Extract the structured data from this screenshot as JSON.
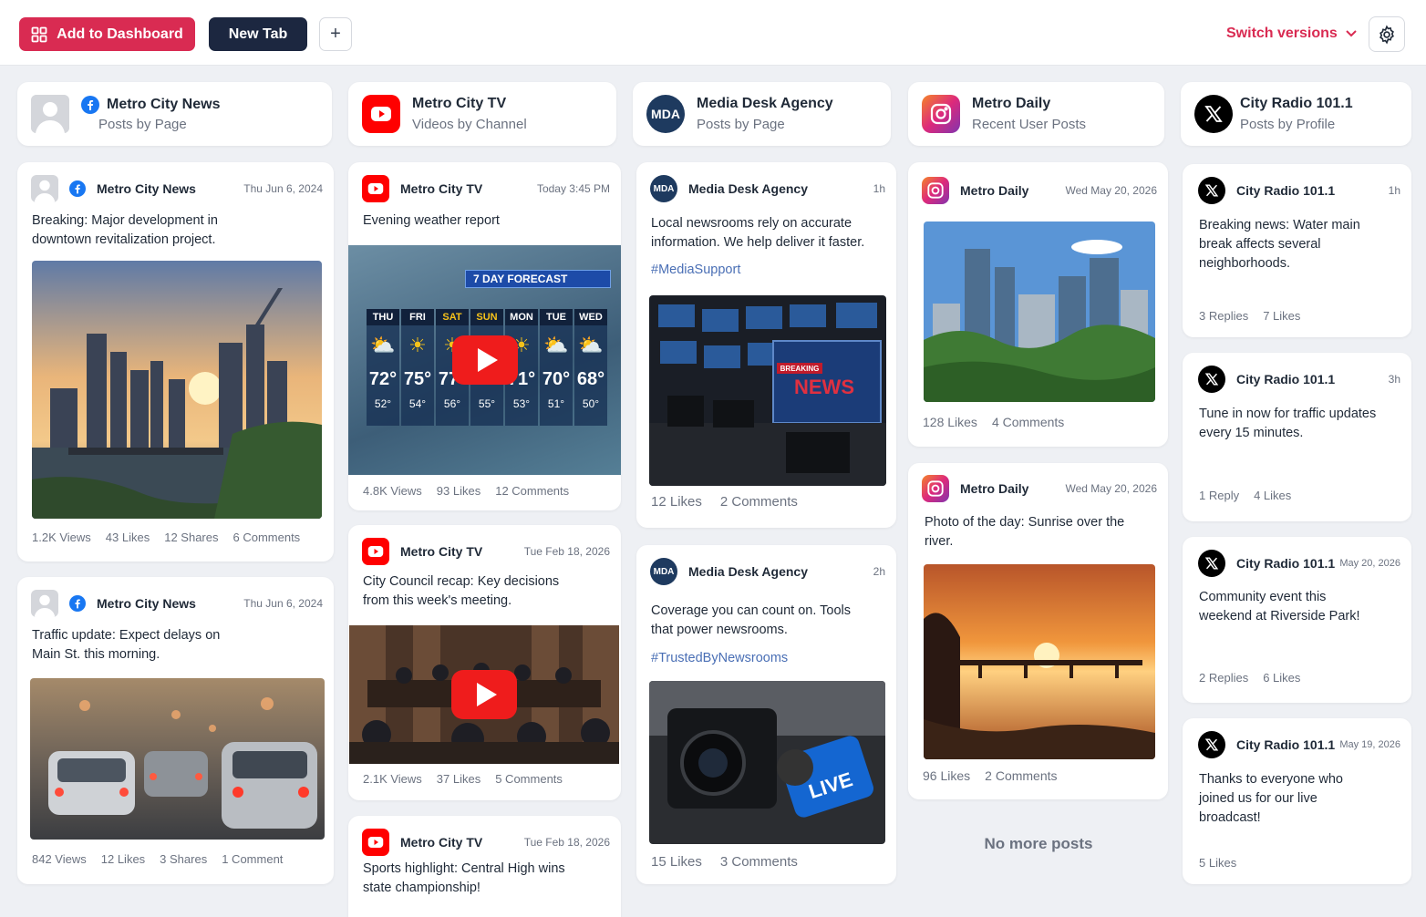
{
  "toolbar": {
    "add_label": "Add to Dashboard",
    "new_tab_label": "New Tab",
    "plus_label": "+",
    "switch_label": "Switch versions"
  },
  "columns": [
    {
      "title": "Metro City News",
      "subtitle": "Posts by Page",
      "network": "facebook"
    },
    {
      "title": "Metro City TV",
      "subtitle": "Videos by Channel",
      "network": "youtube"
    },
    {
      "title": "Media Desk Agency",
      "subtitle": "Posts by Page",
      "avatar_text": "MDA"
    },
    {
      "title": "Metro Daily",
      "subtitle": "Recent User Posts",
      "network": "instagram"
    },
    {
      "title": "City Radio 101.1",
      "subtitle": "Posts by Profile",
      "network": "x"
    }
  ],
  "posts": {
    "fb1": {
      "name": "Metro City News",
      "date": "Thu Jun 6, 2024",
      "text": "Breaking: Major development in downtown revitalization project.",
      "stats": [
        "1.2K Views",
        "43 Likes",
        "12 Shares",
        "6 Comments"
      ]
    },
    "fb2": {
      "name": "Metro City News",
      "date": "Thu Jun 6, 2024",
      "text": "Traffic update: Expect delays on Main St. this morning.",
      "stats": [
        "842 Views",
        "12 Likes",
        "3 Shares",
        "1 Comment"
      ]
    },
    "yt1": {
      "name": "Metro City TV",
      "date": "Today 3:45 PM",
      "text": "Evening weather report",
      "stats": [
        "4.8K Views",
        "93 Likes",
        "12 Comments"
      ]
    },
    "yt2": {
      "name": "Metro City TV",
      "date": "Tue Feb 18, 2026",
      "text": "City Council recap: Key decisions from this week's meeting.",
      "stats": [
        "2.1K Views",
        "37 Likes",
        "5 Comments"
      ]
    },
    "yt3": {
      "name": "Metro City TV",
      "date": "Tue Feb 18, 2026",
      "text": "Sports highlight: Central High wins state championship!"
    },
    "md1": {
      "name": "Media Desk Agency",
      "date": "1h",
      "text": "Local newsrooms rely on accurate information. We help deliver it faster.",
      "tag": "#MediaSupport",
      "stats": [
        "12 Likes",
        "2 Comments"
      ]
    },
    "md2": {
      "name": "Media Desk Agency",
      "date": "2h",
      "text": "Coverage you can count on. Tools that power newsrooms.",
      "tag": "#TrustedByNewsrooms",
      "stats": [
        "15 Likes",
        "3 Comments"
      ]
    },
    "ig1": {
      "name": "Metro Daily",
      "date": "Wed May 20, 2026",
      "stats": [
        "128 Likes",
        "4 Comments"
      ]
    },
    "ig2": {
      "name": "Metro Daily",
      "date": "Wed May 20, 2026",
      "text": "Photo of the day: Sunrise over the river.",
      "stats": [
        "96 Likes",
        "2 Comments"
      ]
    },
    "x1": {
      "name": "City Radio 101.1",
      "date": "1h",
      "text": "Breaking news: Water main break affects several neighborhoods.",
      "stats": [
        "3 Replies",
        "7 Likes"
      ]
    },
    "x2": {
      "name": "City Radio 101.1",
      "date": "3h",
      "text": "Tune in now for traffic updates every 15 minutes.",
      "stats": [
        "1 Reply",
        "4 Likes"
      ]
    },
    "x3": {
      "name": "City Radio 101.1",
      "date": "May 20, 2026",
      "text": "Community event this weekend at Riverside Park!",
      "stats": [
        "2 Replies",
        "6 Likes"
      ]
    },
    "x4": {
      "name": "City Radio 101.1",
      "date": "May 19, 2026",
      "text": "Thanks to everyone who joined us for our live broadcast!",
      "stats": [
        "5 Likes"
      ]
    }
  },
  "avatar_text": "MDA",
  "weather": {
    "title": "7 DAY FORECAST",
    "days": [
      {
        "d": "THU",
        "hi": "72°",
        "lo": "52°",
        "icon": "⛅"
      },
      {
        "d": "FRI",
        "hi": "75°",
        "lo": "54°",
        "icon": "☀"
      },
      {
        "d": "SAT",
        "hi": "77°",
        "lo": "56°",
        "icon": "☀"
      },
      {
        "d": "SUN",
        "hi": "73°",
        "lo": "55°",
        "icon": "☀"
      },
      {
        "d": "MON",
        "hi": "71°",
        "lo": "53°",
        "icon": "☀"
      },
      {
        "d": "TUE",
        "hi": "70°",
        "lo": "51°",
        "icon": "⛅"
      },
      {
        "d": "WED",
        "hi": "68°",
        "lo": "50°",
        "icon": "⛅"
      }
    ]
  },
  "image_text": {
    "breaking": "BREAKING",
    "news": "NEWS",
    "live": "LIVE"
  },
  "no_more_label": "No more posts",
  "colors": {
    "accent": "#d92b52",
    "dark": "#1c2740",
    "facebook": "#1877f2",
    "youtube": "#ff0000",
    "instagram": "#e1306c",
    "x": "#000000",
    "mda": "#1e3a5f"
  }
}
